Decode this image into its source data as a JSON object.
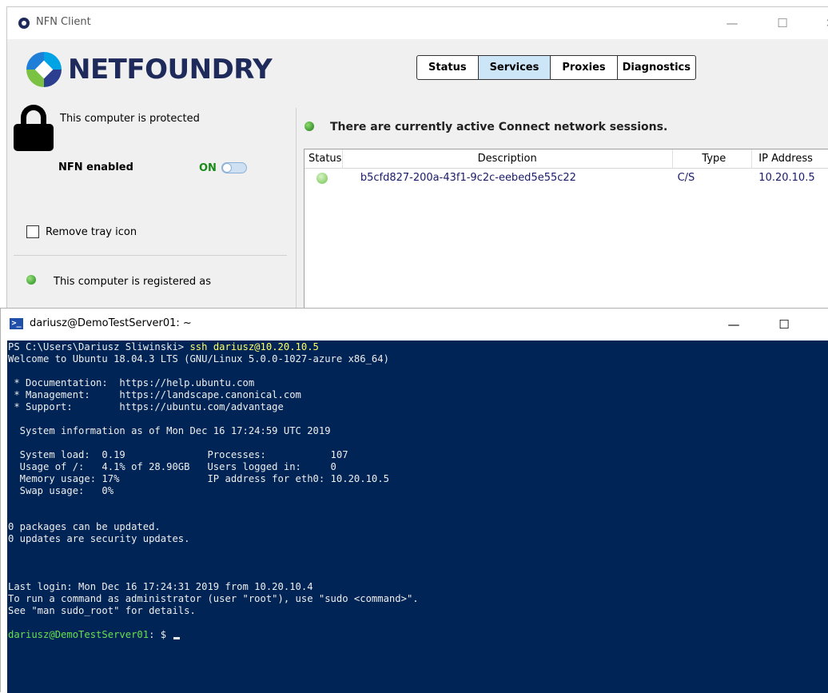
{
  "nfn_window": {
    "title": "NFN Client",
    "controls": {
      "minimize": "—",
      "maximize": "☐",
      "close": "✕"
    },
    "logo_text": "NETFOUNDRY",
    "tabs": [
      {
        "label": "Status",
        "active": false
      },
      {
        "label": "Services",
        "active": true
      },
      {
        "label": "Proxies",
        "active": false
      },
      {
        "label": "Diagnostics",
        "active": false
      }
    ],
    "left_panel": {
      "protected_text": "This computer is protected",
      "nfn_enabled_label": "NFN enabled",
      "toggle_state": "ON",
      "remove_tray_label": "Remove tray icon",
      "remove_tray_checked": false,
      "registered_text": "This computer is registered as"
    },
    "right_panel": {
      "active_message": "There are currently active Connect network sessions.",
      "columns": [
        "Status",
        "Description",
        "Type",
        "IP Address"
      ],
      "rows": [
        {
          "description": "b5cfd827-200a-43f1-9c2c-eebed5e55c22",
          "type": "C/S",
          "ip": "10.20.10.5"
        }
      ]
    }
  },
  "terminal": {
    "title": "dariusz@DemoTestServer01: ~",
    "controls": {
      "minimize": "—",
      "maximize": "☐",
      "close": "✕"
    },
    "prompt_ps": "PS C:\\Users\\Dariusz Sliwinski> ",
    "command": "ssh dariusz@10.20.10.5",
    "lines": [
      "Welcome to Ubuntu 18.04.3 LTS (GNU/Linux 5.0.0-1027-azure x86_64)",
      "",
      " * Documentation:  https://help.ubuntu.com",
      " * Management:     https://landscape.canonical.com",
      " * Support:        https://ubuntu.com/advantage",
      "",
      "  System information as of Mon Dec 16 17:24:59 UTC 2019",
      "",
      "  System load:  0.19              Processes:           107",
      "  Usage of /:   4.1% of 28.90GB   Users logged in:     0",
      "  Memory usage: 17%               IP address for eth0: 10.20.10.5",
      "  Swap usage:   0%",
      "",
      "",
      "0 packages can be updated.",
      "0 updates are security updates.",
      "",
      "",
      "",
      "Last login: Mon Dec 16 17:24:31 2019 from 10.20.10.4",
      "To run a command as administrator (user \"root\"), use \"sudo <command>\".",
      "See \"man sudo_root\" for details.",
      ""
    ],
    "shell_prompt_user": "dariusz@DemoTestServer01",
    "shell_prompt_suffix": ": $ "
  },
  "colors": {
    "terminal_bg": "#012456",
    "logo_navy": "#1e2a5a",
    "active_tab": "#cde6f7",
    "status_green": "#1f8a1f",
    "toggle_on": "#1a8a1a"
  },
  "icons": [
    "nfn-app-icon",
    "netfoundry-logo-icon",
    "lock-icon",
    "status-green-dot-icon",
    "powershell-icon"
  ]
}
